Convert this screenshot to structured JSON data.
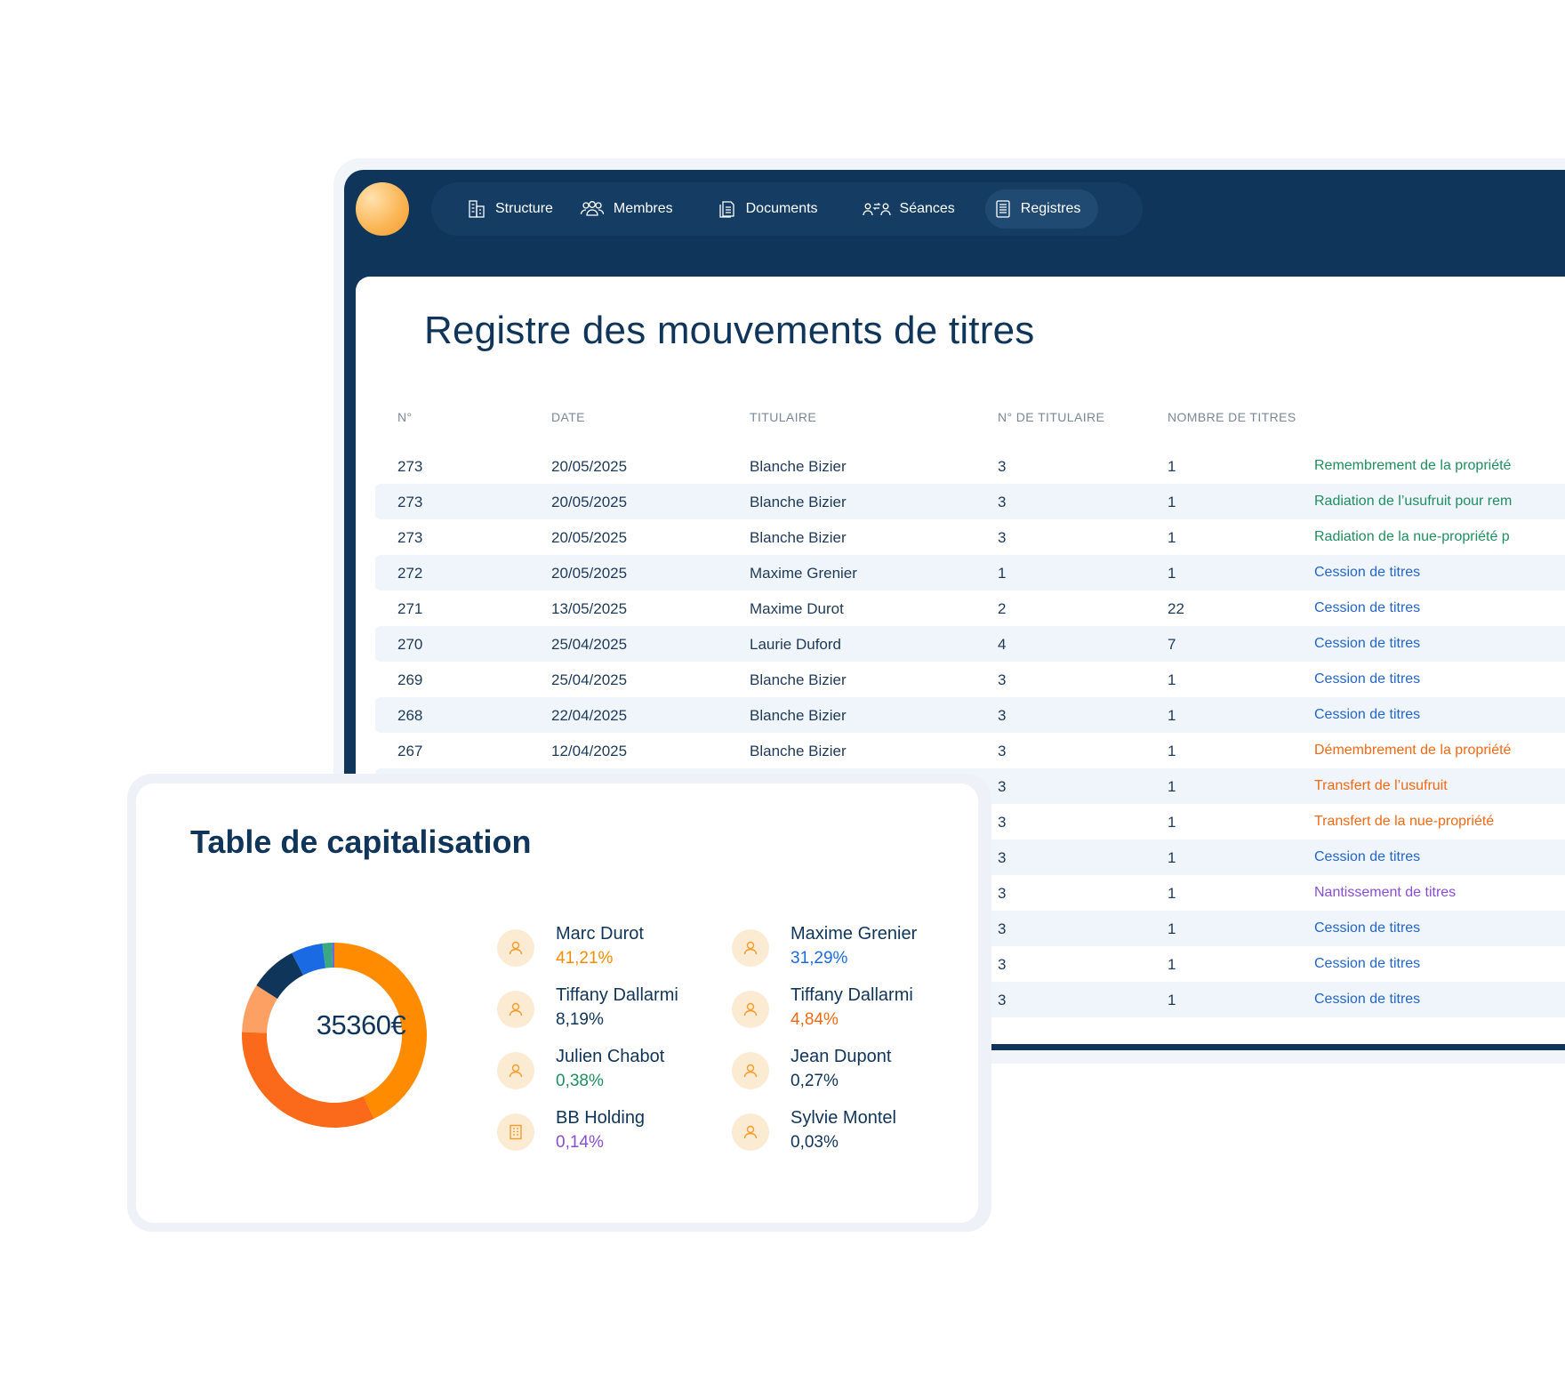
{
  "nav": {
    "items": [
      {
        "label": "Structure",
        "icon": "building-icon"
      },
      {
        "label": "Membres",
        "icon": "users-icon"
      },
      {
        "label": "Documents",
        "icon": "documents-icon"
      },
      {
        "label": "Séances",
        "icon": "meeting-icon"
      },
      {
        "label": "Registres",
        "icon": "register-icon"
      }
    ],
    "active": "Registres"
  },
  "register": {
    "title": "Registre des mouvements de titres",
    "columns": [
      "N°",
      "DATE",
      "TITULAIRE",
      "N° DE TITULAIRE",
      "NOMBRE DE TITRES"
    ],
    "rows": [
      {
        "num": "273",
        "date": "20/05/2025",
        "holder": "Blanche Bizier",
        "holder_num": "3",
        "count": "1",
        "operation": "Remembrement de la propriété",
        "op_type": "green"
      },
      {
        "num": "273",
        "date": "20/05/2025",
        "holder": "Blanche Bizier",
        "holder_num": "3",
        "count": "1",
        "operation": "Radiation de l’usufruit pour rem",
        "op_type": "green"
      },
      {
        "num": "273",
        "date": "20/05/2025",
        "holder": "Blanche Bizier",
        "holder_num": "3",
        "count": "1",
        "operation": "Radiation de la nue-propriété p",
        "op_type": "green"
      },
      {
        "num": "272",
        "date": "20/05/2025",
        "holder": "Maxime Grenier",
        "holder_num": "1",
        "count": "1",
        "operation": "Cession de titres",
        "op_type": "blue"
      },
      {
        "num": "271",
        "date": "13/05/2025",
        "holder": "Maxime Durot",
        "holder_num": "2",
        "count": "22",
        "operation": "Cession de titres",
        "op_type": "blue"
      },
      {
        "num": "270",
        "date": "25/04/2025",
        "holder": "Laurie Duford",
        "holder_num": "4",
        "count": "7",
        "operation": "Cession de titres",
        "op_type": "blue"
      },
      {
        "num": "269",
        "date": "25/04/2025",
        "holder": "Blanche Bizier",
        "holder_num": "3",
        "count": "1",
        "operation": "Cession de titres",
        "op_type": "blue"
      },
      {
        "num": "268",
        "date": "22/04/2025",
        "holder": "Blanche Bizier",
        "holder_num": "3",
        "count": "1",
        "operation": "Cession de titres",
        "op_type": "blue"
      },
      {
        "num": "267",
        "date": "12/04/2025",
        "holder": "Blanche Bizier",
        "holder_num": "3",
        "count": "1",
        "operation": "Démembrement de la propriété",
        "op_type": "orange"
      },
      {
        "num": "",
        "date": "",
        "holder": "",
        "holder_num": "3",
        "count": "1",
        "operation": "Transfert de l’usufruit",
        "op_type": "orange"
      },
      {
        "num": "",
        "date": "",
        "holder": "",
        "holder_num": "3",
        "count": "1",
        "operation": "Transfert de la nue-propriété",
        "op_type": "orange"
      },
      {
        "num": "",
        "date": "",
        "holder": "",
        "holder_num": "3",
        "count": "1",
        "operation": "Cession de titres",
        "op_type": "blue"
      },
      {
        "num": "",
        "date": "",
        "holder": "",
        "holder_num": "3",
        "count": "1",
        "operation": "Nantissement de titres",
        "op_type": "purple"
      },
      {
        "num": "",
        "date": "",
        "holder": "",
        "holder_num": "3",
        "count": "1",
        "operation": "Cession de titres",
        "op_type": "blue"
      },
      {
        "num": "",
        "date": "",
        "holder": "",
        "holder_num": "3",
        "count": "1",
        "operation": "Cession de titres",
        "op_type": "blue"
      },
      {
        "num": "",
        "date": "",
        "holder": "",
        "holder_num": "3",
        "count": "1",
        "operation": "Cession de titres",
        "op_type": "blue"
      }
    ]
  },
  "captable": {
    "title": "Table de capitalisation",
    "total": "35360€",
    "holders": [
      {
        "name": "Marc Durot",
        "pct": "41,21%",
        "value": 41.21,
        "color": "#ff8c00",
        "icon": "user-icon"
      },
      {
        "name": "Maxime Grenier",
        "pct": "31,29%",
        "value": 31.29,
        "color": "#1a6be3",
        "icon": "user-icon"
      },
      {
        "name": "Tiffany Dallarmi",
        "pct": "8,19%",
        "value": 8.19,
        "color": "#0f355a",
        "icon": "user-icon"
      },
      {
        "name": "Tiffany Dallarmi",
        "pct": "4,84%",
        "value": 4.84,
        "color": "#f06a16",
        "icon": "user-icon"
      },
      {
        "name": "Julien Chabot",
        "pct": "0,38%",
        "value": 0.38,
        "color": "#1f8f5f",
        "icon": "user-icon"
      },
      {
        "name": "Jean Dupont",
        "pct": "0,27%",
        "value": 0.27,
        "color": "#0f355a",
        "icon": "user-icon"
      },
      {
        "name": "BB Holding",
        "pct": "0,14%",
        "value": 0.14,
        "color": "#8a4fd0",
        "icon": "building-icon"
      },
      {
        "name": "Sylvie Montel",
        "pct": "0,03%",
        "value": 0.03,
        "color": "#0f355a",
        "icon": "user-icon"
      }
    ]
  },
  "chart_data": {
    "type": "pie",
    "categories": [
      "Marc Durot",
      "Maxime Grenier",
      "Tiffany Dallarmi",
      "Tiffany Dallarmi",
      "Julien Chabot",
      "Jean Dupont",
      "BB Holding",
      "Sylvie Montel"
    ],
    "values": [
      41.21,
      31.29,
      8.19,
      4.84,
      0.38,
      0.27,
      0.14,
      0.03
    ],
    "slices_drawn": [
      {
        "color": "#ff8c00",
        "value": 41.21
      },
      {
        "color": "#fb6a1a",
        "value": 31.29
      },
      {
        "color": "#fda064",
        "value": 8.19
      },
      {
        "color": "#0f355a",
        "value": 8.0
      },
      {
        "color": "#1a6be3",
        "value": 5.3
      },
      {
        "color": "#3aa882",
        "value": 1.6
      },
      {
        "color": "#6d6bd8",
        "value": 0.4
      }
    ],
    "center_label": "35360€"
  }
}
